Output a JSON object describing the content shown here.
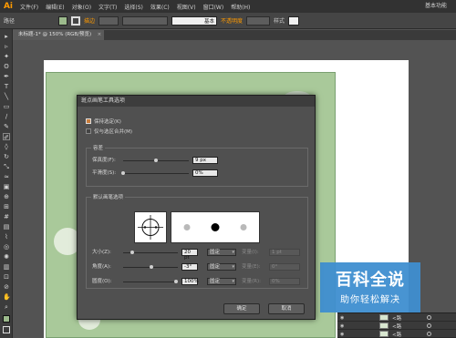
{
  "app": {
    "logo": "Ai",
    "workspace": "基本功能"
  },
  "menu": [
    "文件(F)",
    "编辑(E)",
    "对象(O)",
    "文字(T)",
    "选择(S)",
    "效果(C)",
    "视图(V)",
    "窗口(W)",
    "帮助(H)"
  ],
  "controlbar": {
    "label": "路径",
    "stroke_label": "描边",
    "brush_label": "基本",
    "opacity_label": "不透明度",
    "style_label": "样式",
    "fill_color": "#9cba8c"
  },
  "document_tab": {
    "title": "未标题-1* @ 150% (RGB/预览)",
    "close": "×"
  },
  "layers": [
    {
      "name": "<路"
    },
    {
      "name": "<路"
    },
    {
      "name": "<路"
    }
  ],
  "watermark": {
    "title": "百科全说",
    "subtitle": "助你轻松解决"
  },
  "dialog": {
    "title": "斑点画笔工具选项",
    "keep_selected": "保持选定(K)",
    "merge_only_selection": "仅与选区合并(M)",
    "tolerance_group": "容差",
    "fidelity_label": "保真度(F):",
    "fidelity_value": "9 px",
    "fidelity_level": 0.5,
    "smoothness_label": "平滑度(S):",
    "smoothness_value": "0%",
    "smoothness_level": 0.0,
    "brush_group": "默认画笔选项",
    "size_label": "大小(Z):",
    "size_value": "20 pt",
    "size_mode": "固定",
    "size_variation_label": "变量(I):",
    "size_variation_value": "1 pt",
    "angle_label": "角度(A):",
    "angle_value": "-3°",
    "angle_mode": "固定",
    "angle_variation_label": "变量(E):",
    "angle_variation_value": "0°",
    "roundness_label": "圆度(O):",
    "roundness_value": "100%",
    "roundness_mode": "固定",
    "roundness_variation_label": "变量(R):",
    "roundness_variation_value": "0%",
    "ok_label": "确定",
    "cancel_label": "取消"
  }
}
